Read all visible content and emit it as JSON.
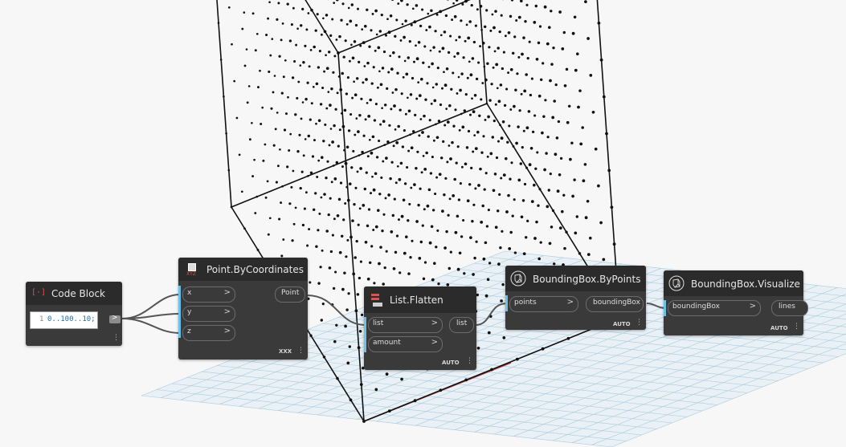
{
  "colors": {
    "background": "#f7f7f7",
    "node_body": "#3a3a3a",
    "node_header": "#2b2b2b",
    "input_accent": "#6ec1e4",
    "wire": "#555555",
    "cube_edges": "#111111",
    "grid": "#a9c9dc",
    "x_axis": "#b33a3a"
  },
  "nodes": {
    "code_block": {
      "title": "Code Block",
      "icon": "code-block-icon",
      "line_number": "1",
      "code": "0..100..10;"
    },
    "point_by_coordinates": {
      "title": "Point.ByCoordinates",
      "icon": "point-icon",
      "icon_caption": "XYZ",
      "inputs": [
        "x",
        "y",
        "z"
      ],
      "output": "Point",
      "lacing": "XXX"
    },
    "list_flatten": {
      "title": "List.Flatten",
      "icon": "list-flatten-icon",
      "inputs": [
        "list",
        "amount"
      ],
      "output": "list",
      "lacing": "AUTO"
    },
    "bounding_box_by_points": {
      "title": "BoundingBox.ByPoints",
      "icon": "bounding-box-icon",
      "inputs": [
        "points"
      ],
      "output": "boundingBox",
      "lacing": "AUTO"
    },
    "bounding_box_visualize": {
      "title": "BoundingBox.Visualize",
      "icon": "bounding-box-icon",
      "inputs": [
        "boundingBox"
      ],
      "output": "lines",
      "lacing": "AUTO"
    }
  },
  "glyphs": {
    "chevron": ">",
    "menu": "⋮"
  }
}
